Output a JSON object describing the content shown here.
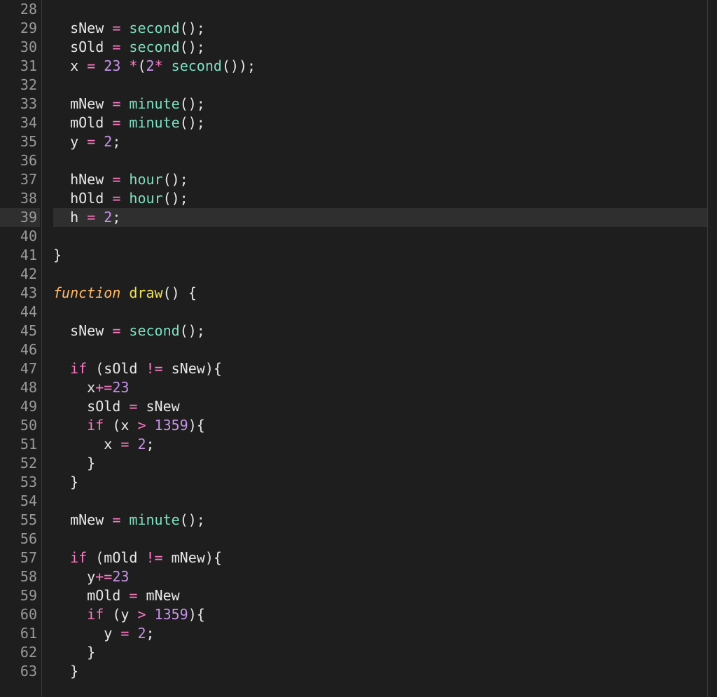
{
  "editor": {
    "highlighted_line": 39,
    "lines": [
      {
        "num": 28,
        "fold": false,
        "tokens": []
      },
      {
        "num": 29,
        "fold": false,
        "tokens": [
          {
            "t": "  ",
            "c": "default"
          },
          {
            "t": "sNew",
            "c": "var"
          },
          {
            "t": " ",
            "c": "default"
          },
          {
            "t": "=",
            "c": "op"
          },
          {
            "t": " ",
            "c": "default"
          },
          {
            "t": "second",
            "c": "func"
          },
          {
            "t": "()",
            "c": "paren"
          },
          {
            "t": ";",
            "c": "semi"
          }
        ]
      },
      {
        "num": 30,
        "fold": false,
        "tokens": [
          {
            "t": "  ",
            "c": "default"
          },
          {
            "t": "sOld",
            "c": "var"
          },
          {
            "t": " ",
            "c": "default"
          },
          {
            "t": "=",
            "c": "op"
          },
          {
            "t": " ",
            "c": "default"
          },
          {
            "t": "second",
            "c": "func"
          },
          {
            "t": "()",
            "c": "paren"
          },
          {
            "t": ";",
            "c": "semi"
          }
        ]
      },
      {
        "num": 31,
        "fold": false,
        "tokens": [
          {
            "t": "  ",
            "c": "default"
          },
          {
            "t": "x",
            "c": "var"
          },
          {
            "t": " ",
            "c": "default"
          },
          {
            "t": "=",
            "c": "op"
          },
          {
            "t": " ",
            "c": "default"
          },
          {
            "t": "23",
            "c": "num"
          },
          {
            "t": " ",
            "c": "default"
          },
          {
            "t": "*",
            "c": "op"
          },
          {
            "t": "(",
            "c": "paren"
          },
          {
            "t": "2",
            "c": "num"
          },
          {
            "t": "*",
            "c": "op"
          },
          {
            "t": " ",
            "c": "default"
          },
          {
            "t": "second",
            "c": "func"
          },
          {
            "t": "())",
            "c": "paren"
          },
          {
            "t": ";",
            "c": "semi"
          }
        ]
      },
      {
        "num": 32,
        "fold": false,
        "tokens": []
      },
      {
        "num": 33,
        "fold": false,
        "tokens": [
          {
            "t": "  ",
            "c": "default"
          },
          {
            "t": "mNew",
            "c": "var"
          },
          {
            "t": " ",
            "c": "default"
          },
          {
            "t": "=",
            "c": "op"
          },
          {
            "t": " ",
            "c": "default"
          },
          {
            "t": "minute",
            "c": "func"
          },
          {
            "t": "()",
            "c": "paren"
          },
          {
            "t": ";",
            "c": "semi"
          }
        ]
      },
      {
        "num": 34,
        "fold": false,
        "tokens": [
          {
            "t": "  ",
            "c": "default"
          },
          {
            "t": "mOld",
            "c": "var"
          },
          {
            "t": " ",
            "c": "default"
          },
          {
            "t": "=",
            "c": "op"
          },
          {
            "t": " ",
            "c": "default"
          },
          {
            "t": "minute",
            "c": "func"
          },
          {
            "t": "()",
            "c": "paren"
          },
          {
            "t": ";",
            "c": "semi"
          }
        ]
      },
      {
        "num": 35,
        "fold": false,
        "tokens": [
          {
            "t": "  ",
            "c": "default"
          },
          {
            "t": "y",
            "c": "var"
          },
          {
            "t": " ",
            "c": "default"
          },
          {
            "t": "=",
            "c": "op"
          },
          {
            "t": " ",
            "c": "default"
          },
          {
            "t": "2",
            "c": "num"
          },
          {
            "t": ";",
            "c": "semi"
          }
        ]
      },
      {
        "num": 36,
        "fold": false,
        "tokens": []
      },
      {
        "num": 37,
        "fold": false,
        "tokens": [
          {
            "t": "  ",
            "c": "default"
          },
          {
            "t": "hNew",
            "c": "var"
          },
          {
            "t": " ",
            "c": "default"
          },
          {
            "t": "=",
            "c": "op"
          },
          {
            "t": " ",
            "c": "default"
          },
          {
            "t": "hour",
            "c": "func"
          },
          {
            "t": "()",
            "c": "paren"
          },
          {
            "t": ";",
            "c": "semi"
          }
        ]
      },
      {
        "num": 38,
        "fold": false,
        "tokens": [
          {
            "t": "  ",
            "c": "default"
          },
          {
            "t": "hOld",
            "c": "var"
          },
          {
            "t": " ",
            "c": "default"
          },
          {
            "t": "=",
            "c": "op"
          },
          {
            "t": " ",
            "c": "default"
          },
          {
            "t": "hour",
            "c": "func"
          },
          {
            "t": "()",
            "c": "paren"
          },
          {
            "t": ";",
            "c": "semi"
          }
        ]
      },
      {
        "num": 39,
        "fold": false,
        "tokens": [
          {
            "t": "  ",
            "c": "default"
          },
          {
            "t": "h",
            "c": "var"
          },
          {
            "t": " ",
            "c": "default"
          },
          {
            "t": "=",
            "c": "op"
          },
          {
            "t": " ",
            "c": "default"
          },
          {
            "t": "2",
            "c": "num"
          },
          {
            "t": ";",
            "c": "semi"
          }
        ]
      },
      {
        "num": 40,
        "fold": false,
        "tokens": []
      },
      {
        "num": 41,
        "fold": false,
        "tokens": [
          {
            "t": "}",
            "c": "brace"
          }
        ]
      },
      {
        "num": 42,
        "fold": false,
        "tokens": []
      },
      {
        "num": 43,
        "fold": true,
        "tokens": [
          {
            "t": "function",
            "c": "keyword-decl"
          },
          {
            "t": " ",
            "c": "default"
          },
          {
            "t": "draw",
            "c": "funcname"
          },
          {
            "t": "()",
            "c": "paren"
          },
          {
            "t": " ",
            "c": "default"
          },
          {
            "t": "{",
            "c": "brace"
          }
        ]
      },
      {
        "num": 44,
        "fold": false,
        "tokens": []
      },
      {
        "num": 45,
        "fold": false,
        "tokens": [
          {
            "t": "  ",
            "c": "default"
          },
          {
            "t": "sNew",
            "c": "var"
          },
          {
            "t": " ",
            "c": "default"
          },
          {
            "t": "=",
            "c": "op"
          },
          {
            "t": " ",
            "c": "default"
          },
          {
            "t": "second",
            "c": "func"
          },
          {
            "t": "()",
            "c": "paren"
          },
          {
            "t": ";",
            "c": "semi"
          }
        ]
      },
      {
        "num": 46,
        "fold": false,
        "tokens": []
      },
      {
        "num": 47,
        "fold": true,
        "tokens": [
          {
            "t": "  ",
            "c": "default"
          },
          {
            "t": "if",
            "c": "keyword"
          },
          {
            "t": " ",
            "c": "default"
          },
          {
            "t": "(",
            "c": "paren"
          },
          {
            "t": "sOld",
            "c": "var"
          },
          {
            "t": " ",
            "c": "default"
          },
          {
            "t": "!=",
            "c": "op"
          },
          {
            "t": " ",
            "c": "default"
          },
          {
            "t": "sNew",
            "c": "var"
          },
          {
            "t": ")",
            "c": "paren"
          },
          {
            "t": "{",
            "c": "brace"
          }
        ]
      },
      {
        "num": 48,
        "fold": false,
        "tokens": [
          {
            "t": "    ",
            "c": "default"
          },
          {
            "t": "x",
            "c": "var"
          },
          {
            "t": "+=",
            "c": "op"
          },
          {
            "t": "23",
            "c": "num"
          }
        ]
      },
      {
        "num": 49,
        "fold": false,
        "tokens": [
          {
            "t": "    ",
            "c": "default"
          },
          {
            "t": "sOld",
            "c": "var"
          },
          {
            "t": " ",
            "c": "default"
          },
          {
            "t": "=",
            "c": "op"
          },
          {
            "t": " ",
            "c": "default"
          },
          {
            "t": "sNew",
            "c": "var"
          }
        ]
      },
      {
        "num": 50,
        "fold": true,
        "tokens": [
          {
            "t": "    ",
            "c": "default"
          },
          {
            "t": "if",
            "c": "keyword"
          },
          {
            "t": " ",
            "c": "default"
          },
          {
            "t": "(",
            "c": "paren"
          },
          {
            "t": "x",
            "c": "var"
          },
          {
            "t": " ",
            "c": "default"
          },
          {
            "t": ">",
            "c": "op"
          },
          {
            "t": " ",
            "c": "default"
          },
          {
            "t": "1359",
            "c": "num"
          },
          {
            "t": ")",
            "c": "paren"
          },
          {
            "t": "{",
            "c": "brace"
          }
        ]
      },
      {
        "num": 51,
        "fold": false,
        "tokens": [
          {
            "t": "      ",
            "c": "default"
          },
          {
            "t": "x",
            "c": "var"
          },
          {
            "t": " ",
            "c": "default"
          },
          {
            "t": "=",
            "c": "op"
          },
          {
            "t": " ",
            "c": "default"
          },
          {
            "t": "2",
            "c": "num"
          },
          {
            "t": ";",
            "c": "semi"
          }
        ]
      },
      {
        "num": 52,
        "fold": false,
        "tokens": [
          {
            "t": "    ",
            "c": "default"
          },
          {
            "t": "}",
            "c": "brace"
          }
        ]
      },
      {
        "num": 53,
        "fold": false,
        "tokens": [
          {
            "t": "  ",
            "c": "default"
          },
          {
            "t": "}",
            "c": "brace"
          }
        ]
      },
      {
        "num": 54,
        "fold": false,
        "tokens": []
      },
      {
        "num": 55,
        "fold": false,
        "tokens": [
          {
            "t": "  ",
            "c": "default"
          },
          {
            "t": "mNew",
            "c": "var"
          },
          {
            "t": " ",
            "c": "default"
          },
          {
            "t": "=",
            "c": "op"
          },
          {
            "t": " ",
            "c": "default"
          },
          {
            "t": "minute",
            "c": "func"
          },
          {
            "t": "()",
            "c": "paren"
          },
          {
            "t": ";",
            "c": "semi"
          }
        ]
      },
      {
        "num": 56,
        "fold": false,
        "tokens": []
      },
      {
        "num": 57,
        "fold": true,
        "tokens": [
          {
            "t": "  ",
            "c": "default"
          },
          {
            "t": "if",
            "c": "keyword"
          },
          {
            "t": " ",
            "c": "default"
          },
          {
            "t": "(",
            "c": "paren"
          },
          {
            "t": "mOld",
            "c": "var"
          },
          {
            "t": " ",
            "c": "default"
          },
          {
            "t": "!=",
            "c": "op"
          },
          {
            "t": " ",
            "c": "default"
          },
          {
            "t": "mNew",
            "c": "var"
          },
          {
            "t": ")",
            "c": "paren"
          },
          {
            "t": "{",
            "c": "brace"
          }
        ]
      },
      {
        "num": 58,
        "fold": false,
        "tokens": [
          {
            "t": "    ",
            "c": "default"
          },
          {
            "t": "y",
            "c": "var"
          },
          {
            "t": "+=",
            "c": "op"
          },
          {
            "t": "23",
            "c": "num"
          }
        ]
      },
      {
        "num": 59,
        "fold": false,
        "tokens": [
          {
            "t": "    ",
            "c": "default"
          },
          {
            "t": "mOld",
            "c": "var"
          },
          {
            "t": " ",
            "c": "default"
          },
          {
            "t": "=",
            "c": "op"
          },
          {
            "t": " ",
            "c": "default"
          },
          {
            "t": "mNew",
            "c": "var"
          }
        ]
      },
      {
        "num": 60,
        "fold": true,
        "tokens": [
          {
            "t": "    ",
            "c": "default"
          },
          {
            "t": "if",
            "c": "keyword"
          },
          {
            "t": " ",
            "c": "default"
          },
          {
            "t": "(",
            "c": "paren"
          },
          {
            "t": "y",
            "c": "var"
          },
          {
            "t": " ",
            "c": "default"
          },
          {
            "t": ">",
            "c": "op"
          },
          {
            "t": " ",
            "c": "default"
          },
          {
            "t": "1359",
            "c": "num"
          },
          {
            "t": ")",
            "c": "paren"
          },
          {
            "t": "{",
            "c": "brace"
          }
        ]
      },
      {
        "num": 61,
        "fold": false,
        "tokens": [
          {
            "t": "      ",
            "c": "default"
          },
          {
            "t": "y",
            "c": "var"
          },
          {
            "t": " ",
            "c": "default"
          },
          {
            "t": "=",
            "c": "op"
          },
          {
            "t": " ",
            "c": "default"
          },
          {
            "t": "2",
            "c": "num"
          },
          {
            "t": ";",
            "c": "semi"
          }
        ]
      },
      {
        "num": 62,
        "fold": false,
        "tokens": [
          {
            "t": "    ",
            "c": "default"
          },
          {
            "t": "}",
            "c": "brace"
          }
        ]
      },
      {
        "num": 63,
        "fold": false,
        "tokens": [
          {
            "t": "  ",
            "c": "default"
          },
          {
            "t": "}",
            "c": "brace"
          }
        ]
      }
    ]
  }
}
